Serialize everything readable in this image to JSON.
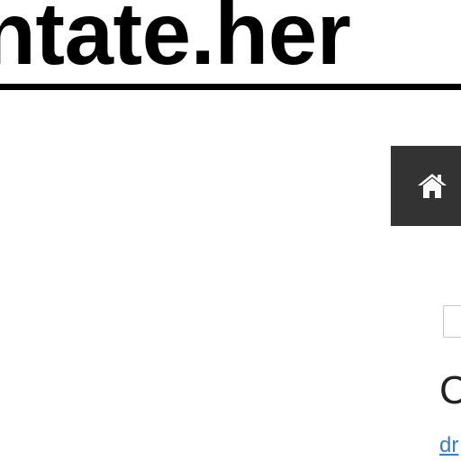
{
  "header": {
    "site_title": "ntate.her"
  },
  "nav": {
    "home_icon": "home-icon",
    "background_color": "#333333",
    "icon_color": "#ffffff"
  },
  "main": {
    "heading": "C",
    "link_text": "dr",
    "link_color": "#2f7fd6"
  }
}
